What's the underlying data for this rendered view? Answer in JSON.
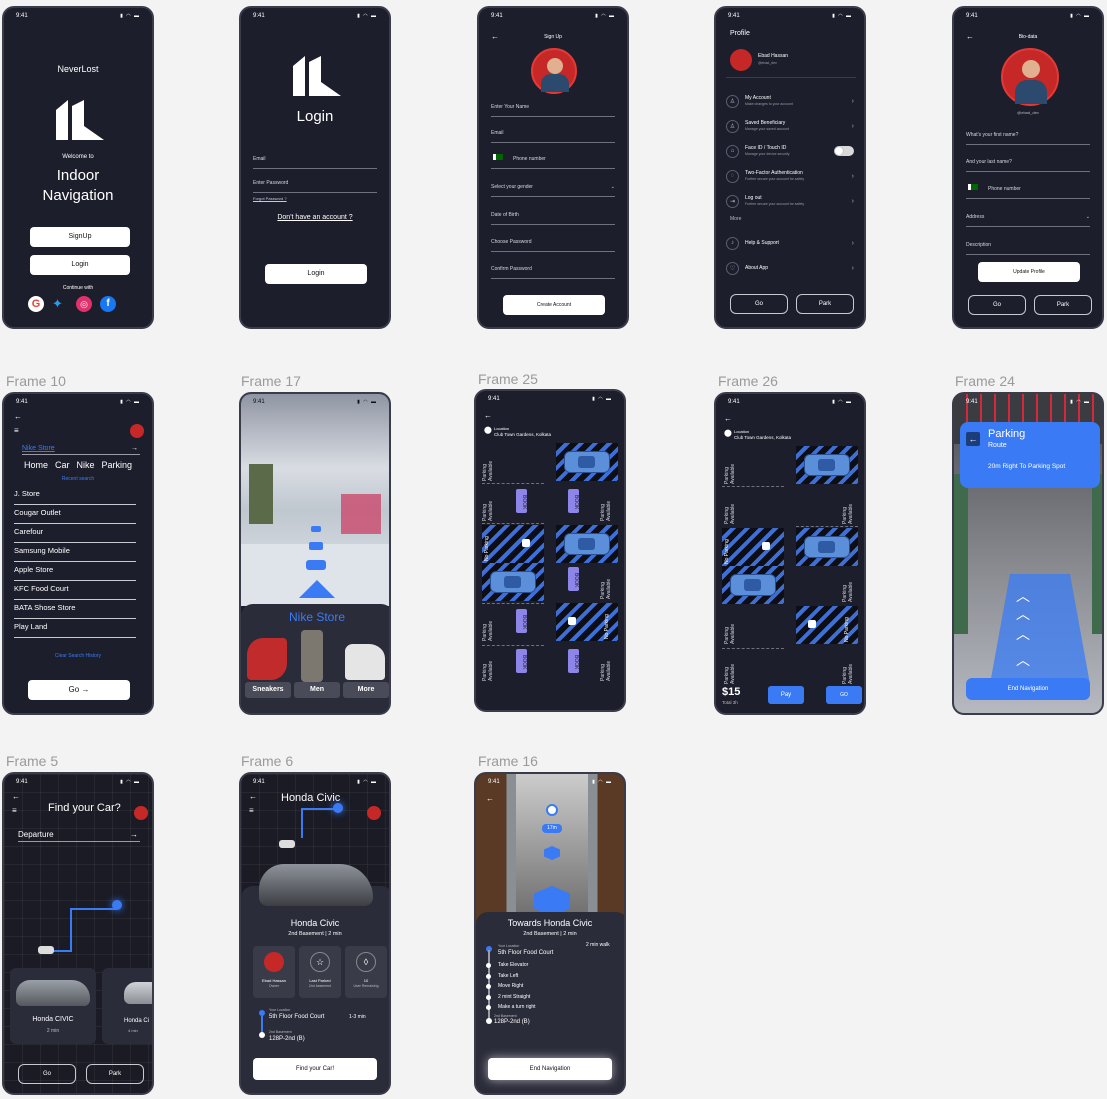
{
  "frame_labels": {
    "f10": "Frame 10",
    "f17": "Frame 17",
    "f25": "Frame 25",
    "f26": "Frame 26",
    "f24": "Frame 24",
    "f5": "Frame 5",
    "f6": "Frame 6",
    "f16": "Frame 16"
  },
  "status": {
    "time": "9:41",
    "icons": "▮ ◠ ▬"
  },
  "splash": {
    "app_name": "NeverLost",
    "welcome": "Welcome to",
    "title": "Indoor Navigation",
    "signup": "SignUp",
    "login": "Login",
    "continue": "Continue with"
  },
  "login": {
    "title": "Login",
    "email": "Email",
    "password": "Enter Password",
    "forgot": "Forgot Password ?",
    "no_account": "Don't have an account ?",
    "button": "Login"
  },
  "signup": {
    "title": "Sign Up",
    "name": "Enter Your Name",
    "email": "Email",
    "phone": "Phone number",
    "gender": "Select your gender",
    "dob": "Date of Birth",
    "password": "Choose Password",
    "confirm": "Confirm Password",
    "button": "Create Account"
  },
  "profile": {
    "title": "Profile",
    "name": "Ebad Hassan",
    "handle": "@ebad_dev",
    "items": [
      {
        "label": "My Account",
        "sub": "Make changes to your account"
      },
      {
        "label": "Saved Beneficiary",
        "sub": "Manage your saved account"
      },
      {
        "label": "Face ID / Touch ID",
        "sub": "Manage your device security"
      },
      {
        "label": "Two-Factor Authentication",
        "sub": "Further secure your account for safety"
      },
      {
        "label": "Log out",
        "sub": "Further secure your account for safety"
      }
    ],
    "more": "More",
    "help": "Help & Support",
    "about": "About App",
    "go": "Go",
    "park": "Park"
  },
  "biodata": {
    "title": "Bio-data",
    "handle": "@ebad_dev",
    "first": "What's your first name?",
    "last": "And your last name?",
    "phone": "Phone number",
    "address": "Address",
    "description": "Description",
    "update": "Update Profile",
    "go": "Go",
    "park": "Park"
  },
  "search": {
    "query": "Nike Store",
    "tabs": [
      "Home",
      "Car",
      "Nike",
      "Parking"
    ],
    "recent": "Recent search",
    "items": [
      "J. Store",
      "Cougar Outlet",
      "Carefour",
      "Samsung Mobile",
      "Apple Store",
      "KFC Food Court",
      "BATA Shose Store",
      "Play Land"
    ],
    "clear": "Clear Search History",
    "go": "Go →"
  },
  "store": {
    "name": "Nike Store",
    "cats": [
      "Sneakers",
      "Men",
      "More"
    ]
  },
  "parking": {
    "loc_label": "Location",
    "loc_value": "Club Town Gardens, Kolkata",
    "available": "Parking Available",
    "no_parking": "No Parking",
    "book": "BOOK",
    "price": "$15",
    "total": "Total 3h",
    "pay": "Pay",
    "go": "GO"
  },
  "route": {
    "title": "Parking",
    "sub": "Route",
    "info": "20m Right To Parking Spot",
    "end": "End Navigation"
  },
  "findcar": {
    "title": "Find your Car?",
    "departure": "Departure",
    "car1": "Honda CIVIC",
    "car1_time": "2 min",
    "car2": "Honda Ci",
    "car2_time": "4 min",
    "go": "Go",
    "park": "Park"
  },
  "civic": {
    "title": "Honda Civic",
    "name": "Honda Civic",
    "level": "2nd Basement | 2 min",
    "owner": "Ebad Hassan",
    "owner_sub": "Owner",
    "last": "Last Parked",
    "last_sub": "2nd basement",
    "users": "10",
    "users_sub": "User Remaining",
    "your_loc": "Your Location",
    "from": "5th Floor Food Court",
    "time": "1-3 min",
    "to_label": "2nd Basement",
    "to": "128P-2nd (B)",
    "button": "Find your Car!"
  },
  "towards": {
    "dist": "17m",
    "title": "Towards Honda Civic",
    "level": "2nd Basement | 2 min",
    "your_loc": "Your Location",
    "walk": "2 min walk",
    "from": "5th Floor Food Court",
    "steps": [
      "Take Elevator",
      "Take Left",
      "Move Right",
      "2 mint Straight",
      "Make a turn right"
    ],
    "to_label": "2nd Basement",
    "to": "128P-2nd (B)",
    "button": "End Navigation"
  }
}
